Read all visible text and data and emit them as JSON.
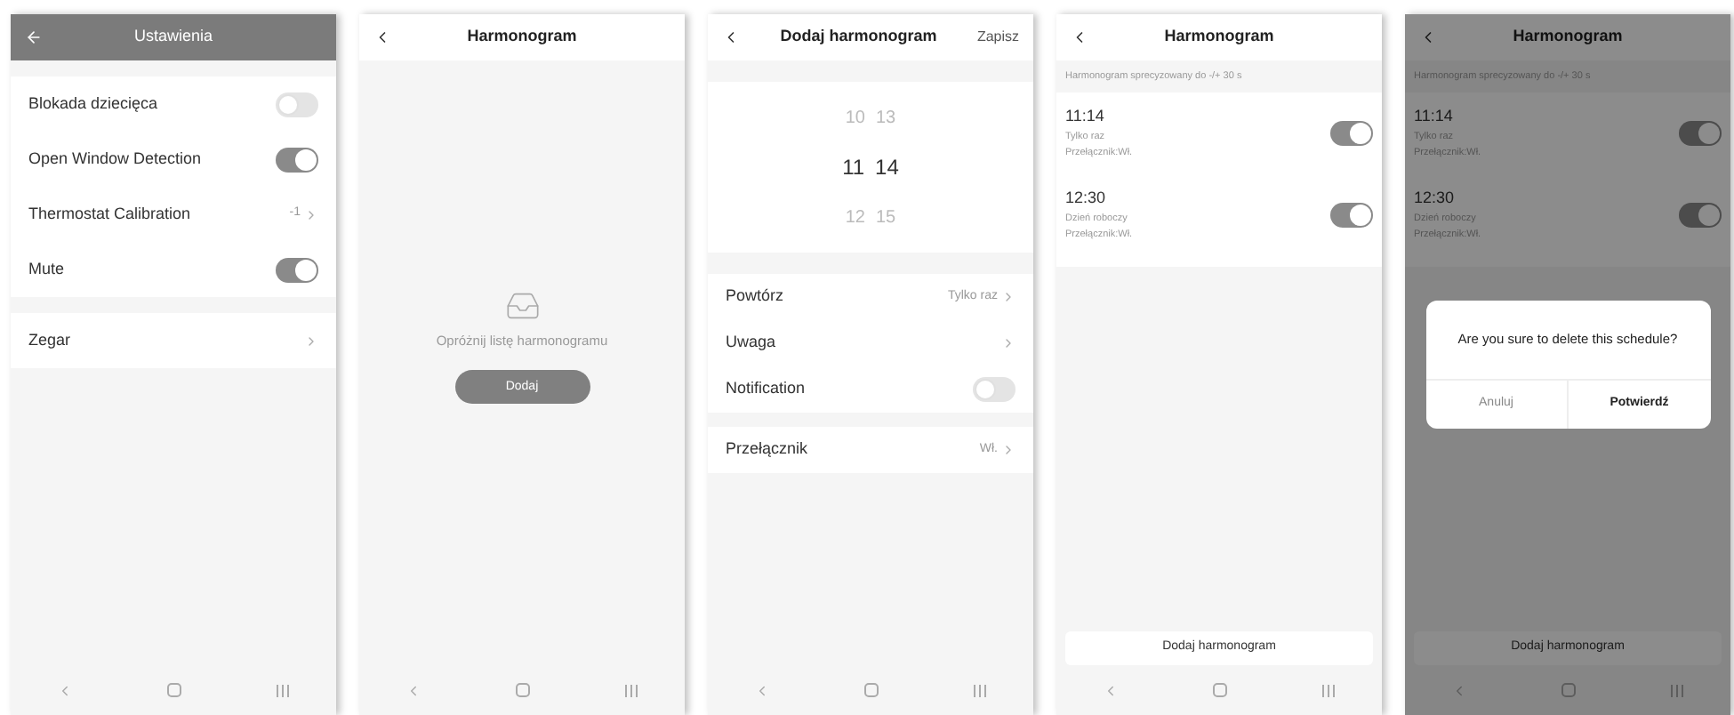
{
  "screens": [
    {
      "kind": "settings",
      "dark_header": true,
      "title": "Ustawienia",
      "groups": [
        [
          {
            "kind": "toggle",
            "label": "Blokada dziecięca",
            "on": false
          },
          {
            "kind": "toggle",
            "label": "Open Window Detection",
            "on": true
          },
          {
            "kind": "value",
            "label": "Thermostat Calibration",
            "value": "-1"
          },
          {
            "kind": "toggle",
            "label": "Mute",
            "on": true
          }
        ],
        [
          {
            "kind": "link",
            "label": "Zegar"
          }
        ]
      ]
    },
    {
      "kind": "empty",
      "dark_header": false,
      "title": "Harmonogram",
      "message": "Opróżnij listę harmonogramu",
      "button": "Dodaj"
    },
    {
      "kind": "editor",
      "dark_header": false,
      "title": "Dodaj harmonogram",
      "action": "Zapisz",
      "picker": [
        {
          "hour": "10",
          "minute": "13",
          "selected": false
        },
        {
          "hour": "11",
          "minute": "14",
          "selected": true
        },
        {
          "hour": "12",
          "minute": "15",
          "selected": false
        }
      ],
      "groups": [
        [
          {
            "kind": "value",
            "label": "Powtórz",
            "value": "Tylko raz"
          },
          {
            "kind": "link",
            "label": "Uwaga"
          },
          {
            "kind": "toggle",
            "label": "Notification",
            "on": false
          }
        ],
        [
          {
            "kind": "value",
            "label": "Przełącznik",
            "value": "Wł."
          }
        ]
      ]
    },
    {
      "kind": "list",
      "dark_header": false,
      "title": "Harmonogram",
      "note": "Harmonogram sprecyzowany do -/+ 30 s",
      "items": [
        {
          "time": "11:14",
          "repeat": "Tylko raz",
          "detail": "Przełącznik:Wł.",
          "on": true
        },
        {
          "time": "12:30",
          "repeat": "Dzień roboczy",
          "detail": "Przełącznik:Wł.",
          "on": true
        }
      ],
      "add_button": "Dodaj harmonogram"
    },
    {
      "kind": "list",
      "dark_header": false,
      "title": "Harmonogram",
      "note": "Harmonogram sprecyzowany do -/+ 30 s",
      "items": [
        {
          "time": "11:14",
          "repeat": "Tylko raz",
          "detail": "Przełącznik:Wł.",
          "on": true
        },
        {
          "time": "12:30",
          "repeat": "Dzień roboczy",
          "detail": "Przełącznik:Wł.",
          "on": true
        }
      ],
      "add_button": "Dodaj harmonogram",
      "dialog": {
        "message": "Are you sure to delete this schedule?",
        "cancel": "Anuluj",
        "confirm": "Potwierdź"
      }
    }
  ]
}
